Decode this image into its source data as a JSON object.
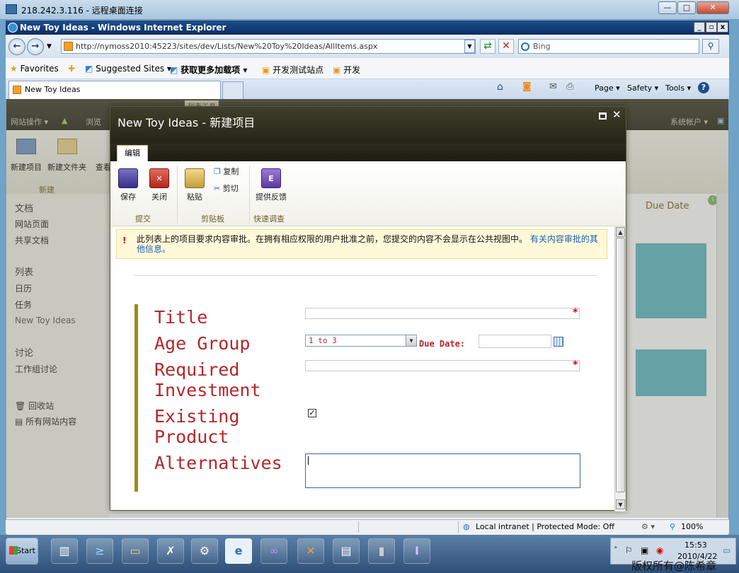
{
  "remote_desktop": {
    "title": "218.242.3.116 - 远程桌面连接",
    "buttons": [
      "—",
      "□",
      "✕"
    ]
  },
  "ie": {
    "title": "New Toy Ideas - Windows Internet Explorer",
    "url": "http://nymoss2010:45223/sites/dev/Lists/New%20Toy%20Ideas/AllItems.aspx",
    "search_placeholder": "Bing",
    "favorites_label": "Favorites",
    "favorites": [
      "Suggested Sites ▾",
      "获取更多加载项 ▾",
      "开发测试站点",
      "开发"
    ],
    "tab_title": "New Toy Ideas",
    "commands": {
      "page": "Page ▾",
      "safety": "Safety ▾",
      "tools": "Tools ▾",
      "help": "?"
    },
    "status": {
      "zone": "Local intranet | Protected Mode: Off",
      "zoom": "100%"
    }
  },
  "sharepoint": {
    "topbar": {
      "site_actions": "网站操作 ▾",
      "browse": "浏览",
      "list_tools": "列表工具",
      "account": "系统帐户 ▾"
    },
    "ribbon": {
      "new_item": "新建项目",
      "new_folder": "新建文件夹",
      "view": "查看",
      "group_new": "新建"
    },
    "nav": {
      "doc_header": "文档",
      "doc_items": [
        "网站页面",
        "共享文档"
      ],
      "list_header": "列表",
      "list_items": [
        "日历",
        "任务",
        "New Toy Ideas"
      ],
      "discuss_header": "讨论",
      "discuss_items": [
        "工作组讨论"
      ],
      "recycle": "回收站",
      "all_content": "所有网站内容"
    },
    "main_column": "Due Date"
  },
  "dialog": {
    "title": "New Toy Ideas - 新建项目",
    "tab": "编辑",
    "ribbon": {
      "save": "保存",
      "close": "关闭",
      "paste": "粘贴",
      "copy": "复制",
      "cut": "剪切",
      "feedback": "提供反馈",
      "group_commit": "提交",
      "group_clipboard": "剪贴板",
      "group_survey": "快速调查"
    },
    "notice": {
      "text": "此列表上的项目要求内容审批。在拥有相应权限的用户批准之前，您提交的内容不会显示在公共视图中。",
      "link": "有关内容审批的其他信息。"
    },
    "form": {
      "title_label": "Title",
      "age_group_label": "Age Group",
      "age_group_value": "1 to 3",
      "due_date_label": "Due Date:",
      "required_investment_label_1": "Required",
      "required_investment_label_2": "Investment",
      "existing_product_label_1": "Existing",
      "existing_product_label_2": "Product",
      "existing_product_checked": true,
      "alternatives_label": "Alternatives",
      "required_marker": "*"
    }
  },
  "taskbar": {
    "start": "Start",
    "clock_time": "15:53",
    "clock_date": "2010/4/22",
    "watermark": "版权所有@陈希章"
  }
}
